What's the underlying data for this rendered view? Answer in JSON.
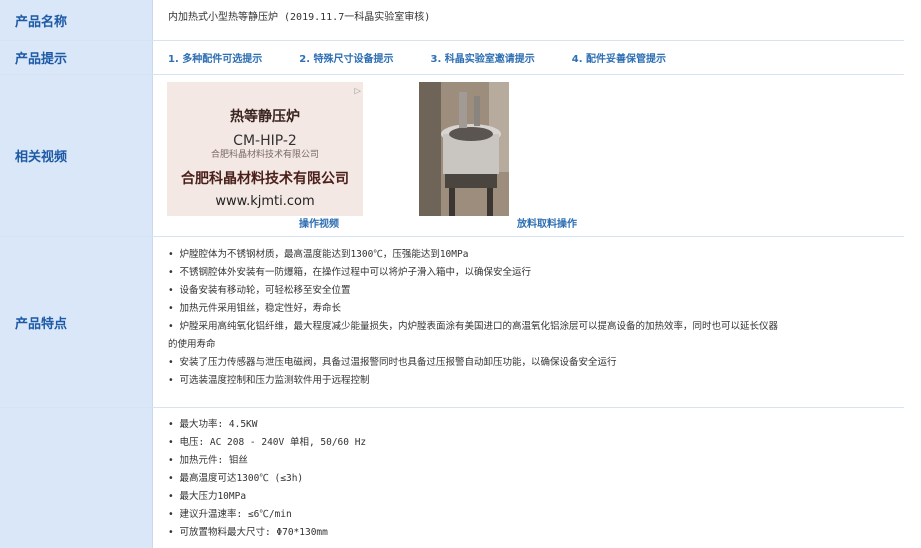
{
  "product_name": {
    "label": "产品名称",
    "value": "内加热式小型热等静压炉 (2019.11.7一科晶实验室审核)"
  },
  "product_tips": {
    "label": "产品提示",
    "items": [
      "1. 多种配件可选提示",
      "2. 特殊尺寸设备提示",
      "3. 科晶实验室邀请提示",
      "4. 配件妥善保管提示"
    ]
  },
  "videos": {
    "label": "相关视频",
    "thumb1_lines": [
      "热等静压炉",
      "CM-HIP-2",
      "合肥科晶材料技术有限公司",
      "合肥科晶材料技术有限公司",
      "www.kjmti.com"
    ],
    "captions": [
      "操作视频",
      "放料取料操作"
    ]
  },
  "features": {
    "label": "产品特点",
    "items": [
      "• 炉膛腔体为不锈钢材质，最高温度能达到1300℃，压强能达到10MPa",
      "• 不锈钢腔体外安装有一防爆箱，在操作过程中可以将炉子滑入箱中，以确保安全运行",
      "• 设备安装有移动轮，可轻松移至安全位置",
      "• 加热元件采用钼丝，稳定性好，寿命长",
      "• 炉膛采用高纯氧化铝纤维，最大程度减少能量损失，内炉膛表面涂有美国进口的高温氧化铝涂层可以提高设备的加热效率，同时也可以延长仪器",
      "的使用寿命",
      "• 安装了压力传感器与泄压电磁阀，具备过温报警同时也具备过压报警自动卸压功能，以确保设备安全运行",
      "• 可选装温度控制和压力监测软件用于远程控制"
    ]
  },
  "specs": {
    "items": [
      "• 最大功率: 4.5KW",
      "• 电压: AC 208 - 240V 单相, 50/60 Hz",
      "• 加热元件: 钼丝",
      "• 最高温度可达1300℃ (≤3h)",
      "• 最大压力10MPa",
      "• 建议升温速率: ≤6℃/min",
      "• 可放置物料最大尺寸: Φ70*130mm"
    ]
  }
}
